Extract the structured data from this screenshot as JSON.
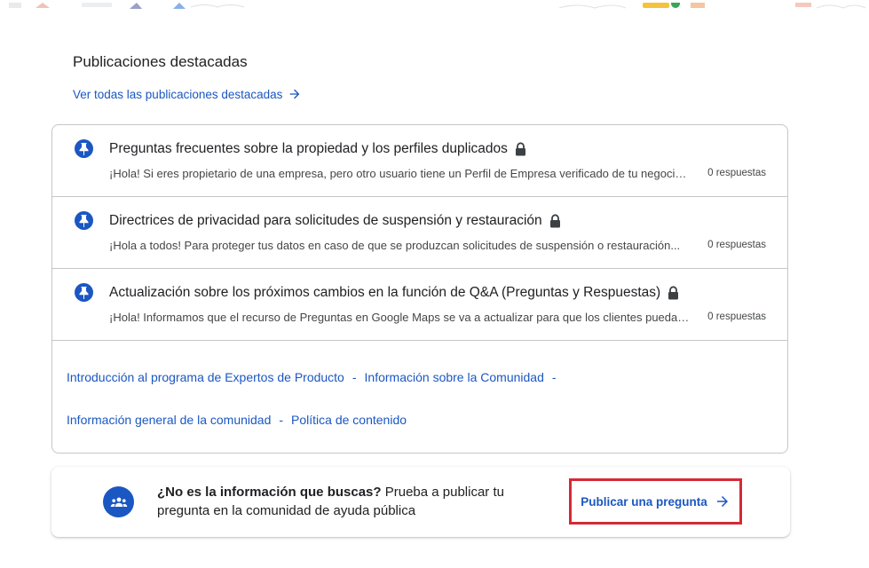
{
  "featured": {
    "title": "Publicaciones destacadas",
    "see_all": "Ver todas las publicaciones destacadas",
    "posts": [
      {
        "title": "Preguntas frecuentes sobre la propiedad y los perfiles duplicados",
        "snippet": "¡Hola! Si eres propietario de una empresa, pero otro usuario tiene un Perfil de Empresa verificado de tu negocio...",
        "count": "0 respuestas"
      },
      {
        "title": "Directrices de privacidad para solicitudes de suspensión y restauración",
        "snippet": "¡Hola a todos! Para proteger tus datos en caso de que se produzcan solicitudes de suspensión o restauración...",
        "count": "0 respuestas"
      },
      {
        "title": "Actualización sobre los próximos cambios en la función de Q&A (Preguntas y Respuestas)",
        "snippet": "¡Hola! Informamos que el recurso de Preguntas en Google Maps se va a actualizar para que los clientes puedan...",
        "count": "0 respuestas"
      }
    ]
  },
  "footer_links": {
    "row1": [
      "Introducción al programa de Expertos de Producto",
      "Información sobre la Comunidad"
    ],
    "row2": [
      "Información general de la comunidad",
      "Política de contenido"
    ],
    "separator": "-"
  },
  "banner": {
    "question": "¿No es la información que buscas?",
    "text": " Prueba a publicar tu pregunta en la comunidad de ayuda pública",
    "button": "Publicar una pregunta"
  },
  "colors": {
    "link": "#1a57c2",
    "highlight_border": "#d42a36",
    "border": "#c4c7c5"
  },
  "icons": {
    "pin": "pushpin-icon",
    "lock": "lock-icon",
    "arrow": "arrow-right-icon",
    "community": "community-icon"
  }
}
